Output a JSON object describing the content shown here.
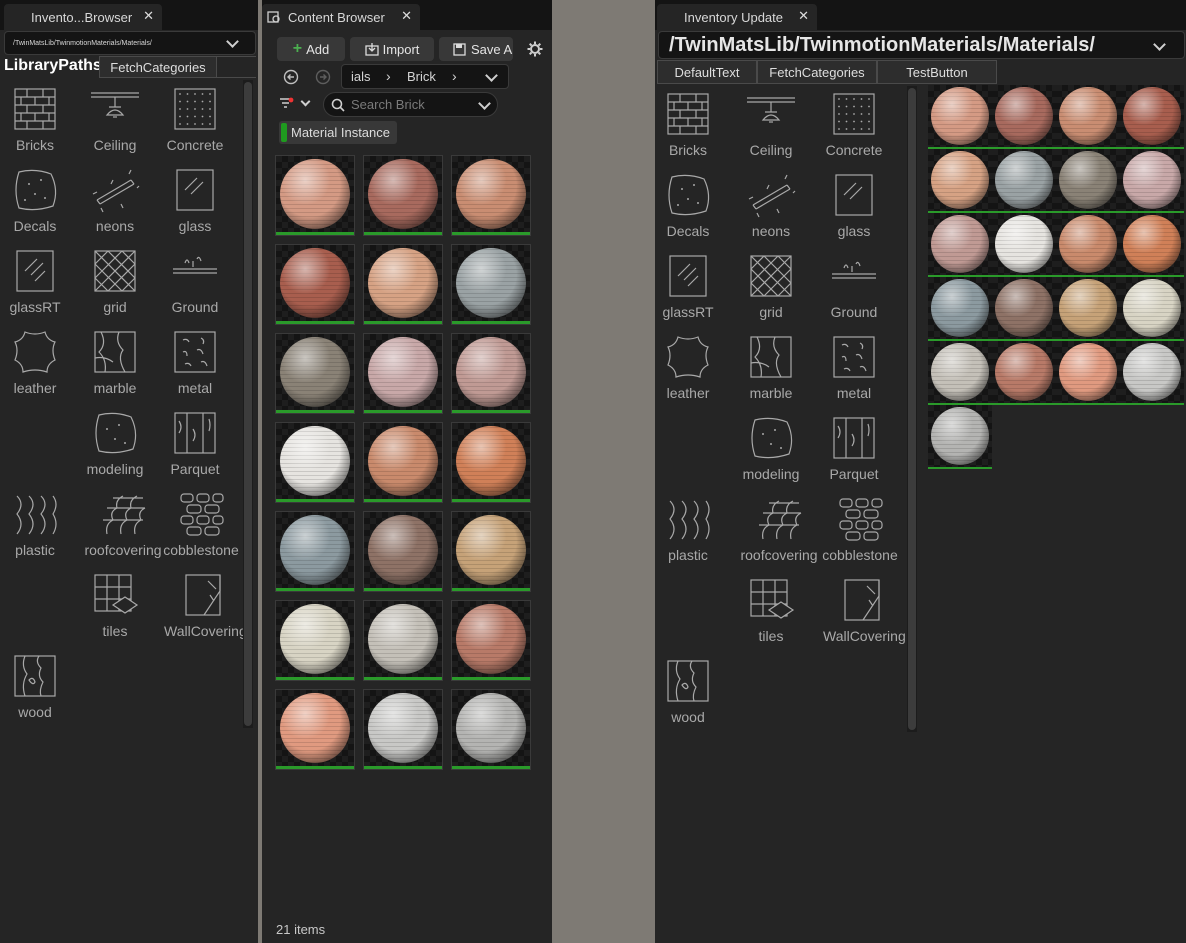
{
  "left_panel": {
    "tab_title": "Invento...Browser",
    "path": "/TwinMatsLib/TwinmotionMaterials/Materials/",
    "tabs": [
      "LibraryPaths",
      "FetchCategories"
    ]
  },
  "content_browser": {
    "tab_title": "Content Browser",
    "add_label": "Add",
    "import_label": "Import",
    "save_label": "Save A",
    "breadcrumb": [
      "ials",
      "Brick"
    ],
    "search_placeholder": "Search Brick",
    "filter_chip": "Material Instance",
    "item_count": "21 items"
  },
  "inventory_update": {
    "tab_title": "Inventory Update",
    "path": "/TwinMatsLib/TwinmotionMaterials/Materials/",
    "buttons": [
      "DefaultText",
      "FetchCategories",
      "TestButton"
    ]
  },
  "categories": [
    {
      "label": "Bricks",
      "icon": "bricks-icon"
    },
    {
      "label": "Ceiling",
      "icon": "ceiling-icon"
    },
    {
      "label": "Concrete",
      "icon": "concrete-icon"
    },
    {
      "label": "Decals",
      "icon": "decals-icon"
    },
    {
      "label": "neons",
      "icon": "neons-icon"
    },
    {
      "label": "glass",
      "icon": "glass-icon"
    },
    {
      "label": "glassRT",
      "icon": "glassrt-icon"
    },
    {
      "label": "grid",
      "icon": "grid-icon"
    },
    {
      "label": "Ground",
      "icon": "ground-icon"
    },
    {
      "label": "leather",
      "icon": "leather-icon"
    },
    {
      "label": "marble",
      "icon": "marble-icon"
    },
    {
      "label": "metal",
      "icon": "metal-icon"
    },
    {
      "label": "modeling",
      "icon": "modeling-icon"
    },
    {
      "label": "Parquet",
      "icon": "parquet-icon"
    },
    {
      "label": "plastic",
      "icon": "plastic-icon"
    },
    {
      "label": "roofcovering",
      "icon": "roofcovering-icon"
    },
    {
      "label": "cobblestone",
      "icon": "cobblestone-icon"
    },
    {
      "label": "tiles",
      "icon": "tiles-icon"
    },
    {
      "label": "WallCovering",
      "icon": "wallcovering-icon"
    },
    {
      "label": "wood",
      "icon": "wood-icon"
    }
  ],
  "materials": [
    {
      "color": "#d49a84"
    },
    {
      "color": "#a86a5e"
    },
    {
      "color": "#c98d72"
    },
    {
      "color": "#a85e4e"
    },
    {
      "color": "#d6a284"
    },
    {
      "color": "#9aa2a4"
    },
    {
      "color": "#8a8276"
    },
    {
      "color": "#c8a8a8"
    },
    {
      "color": "#c09a94"
    },
    {
      "color": "#e6e4e0"
    },
    {
      "color": "#c98a6c"
    },
    {
      "color": "#d08058"
    },
    {
      "color": "#8c9aa0"
    },
    {
      "color": "#8e7266"
    },
    {
      "color": "#c6a278"
    },
    {
      "color": "#d8d4c4"
    },
    {
      "color": "#c4c0b8"
    },
    {
      "color": "#b87a68"
    },
    {
      "color": "#e09a80"
    },
    {
      "color": "#c8c8c6"
    },
    {
      "color": "#b4b4b2"
    }
  ],
  "colors": {
    "status_green": "#2a9a2a",
    "accent_add": "#4caf50"
  }
}
